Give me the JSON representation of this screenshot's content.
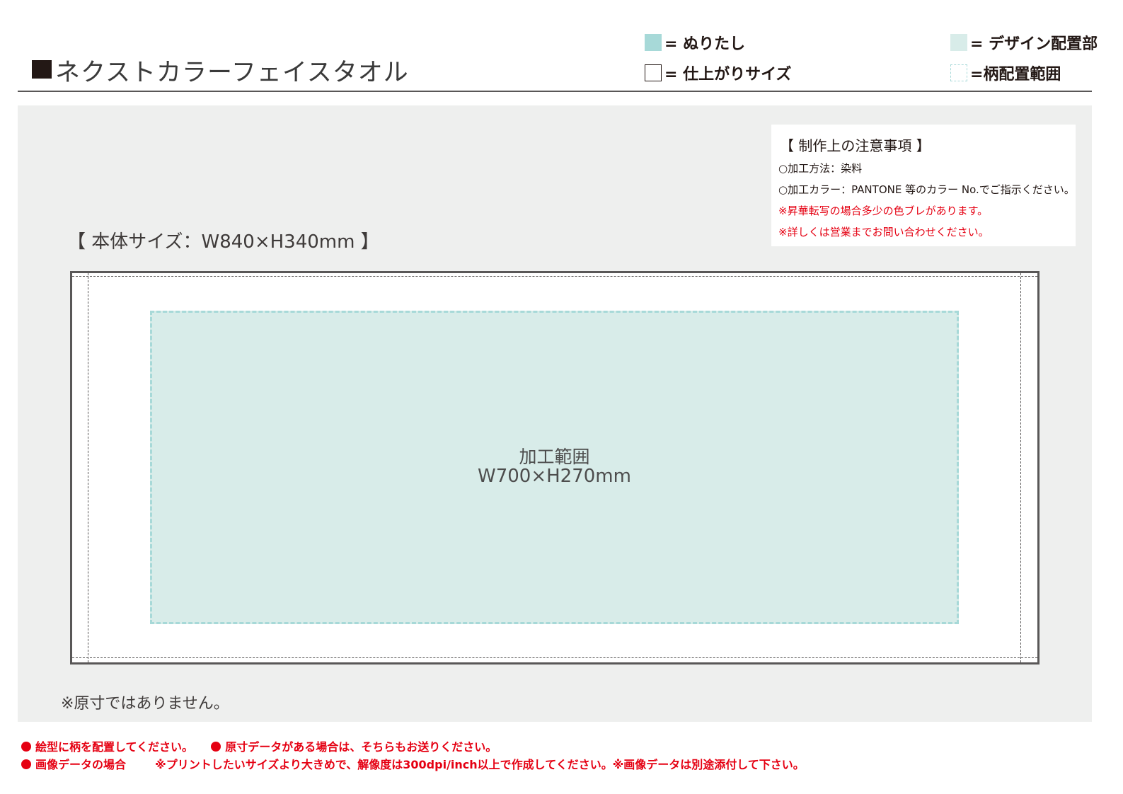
{
  "header": {
    "title": "ネクストカラーフェイスタオル",
    "legend": {
      "bleed": "= ぬりたし",
      "trim": "= 仕上がりサイズ",
      "design": "= デザイン配置部",
      "pattern": "=柄配置範囲"
    },
    "colors": {
      "bleed": "#a7d9d8",
      "design_area": "#d8ece9",
      "warning_red": "#e50012"
    }
  },
  "notes": {
    "title": "【 制作上の注意事項 】",
    "items": [
      "○加工方法：染料",
      "○加工カラー：PANTONE 等のカラー No.でご指示ください。",
      "※昇華転写の場合多少の色ブレがあります。",
      "※詳しくは営業までお問い合わせください。"
    ]
  },
  "template": {
    "body_size": "【 本体サイズ：W840×H340mm 】",
    "design_label": "加工範囲",
    "design_size": "W700×H270mm",
    "not_actual_size": "※原寸ではありません。"
  },
  "footer": {
    "line1_a": "絵型に柄を配置してください。",
    "line1_b": "原寸データがある場合は、そちらもお送りください。",
    "line2_a": "画像データの場合",
    "line2_b": "※プリントしたいサイズより大きめで、解像度は300dpi/inch以上で作成してください。※画像データは別途添付して下さい。"
  }
}
